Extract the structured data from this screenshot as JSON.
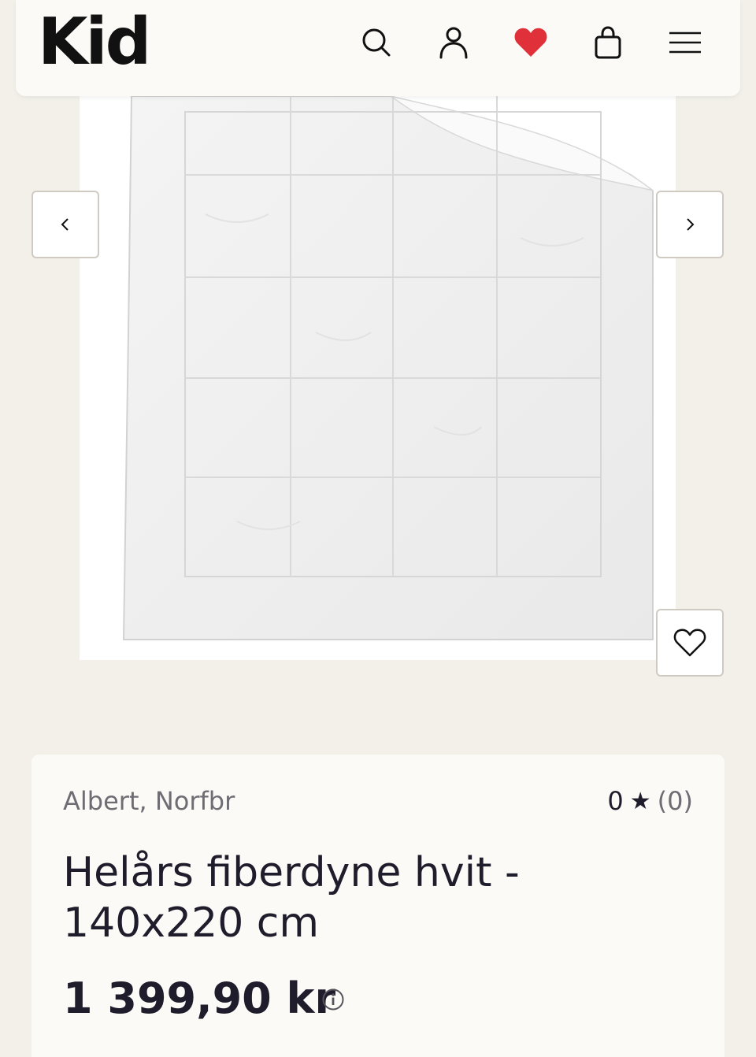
{
  "header": {
    "logo": "Kid",
    "icons": [
      "search-icon",
      "user-icon",
      "heart-icon",
      "bag-icon",
      "menu-icon"
    ],
    "favorite_color": "#e0303a"
  },
  "gallery": {
    "prev_icon": "chevron-left-icon",
    "next_icon": "chevron-right-icon",
    "wishlist_icon": "heart-outline-icon",
    "image_alt": "Helårs fiberdyne hvit"
  },
  "product": {
    "brand": "Albert, Norfbr",
    "rating_score": "0",
    "rating_star": "★",
    "rating_count": "(0)",
    "title": "Helårs fiberdyne hvit - 140x220 cm",
    "price": "1 399,90 kr",
    "price_info_icon": "info-icon"
  },
  "colors": {
    "background": "#f3f0ea",
    "card": "#fbfaf7",
    "text": "#1f1d2b",
    "muted": "#6f6c73"
  }
}
